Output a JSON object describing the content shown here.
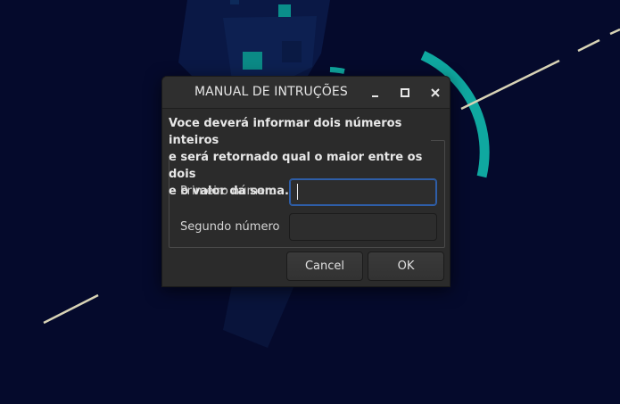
{
  "dialog": {
    "title": "MANUAL DE INTRUÇÕES",
    "message": "Voce deverá informar dois números inteiros\ne será retornado qual o maior entre os dois\ne o valor da soma.",
    "fields": [
      {
        "label": "Primeiro número",
        "value": ""
      },
      {
        "label": "Segundo número",
        "value": ""
      }
    ],
    "buttons": {
      "cancel": "Cancel",
      "ok": "OK"
    },
    "controls": {
      "minimize": "minimize-icon",
      "maximize": "maximize-icon",
      "close": "close-icon"
    }
  },
  "colors": {
    "desktop_bg": "#050a2c",
    "accent_teal": "#0fa8a0",
    "dialog_bg": "#2b2b2b",
    "focus_border": "#2e5ea8"
  }
}
